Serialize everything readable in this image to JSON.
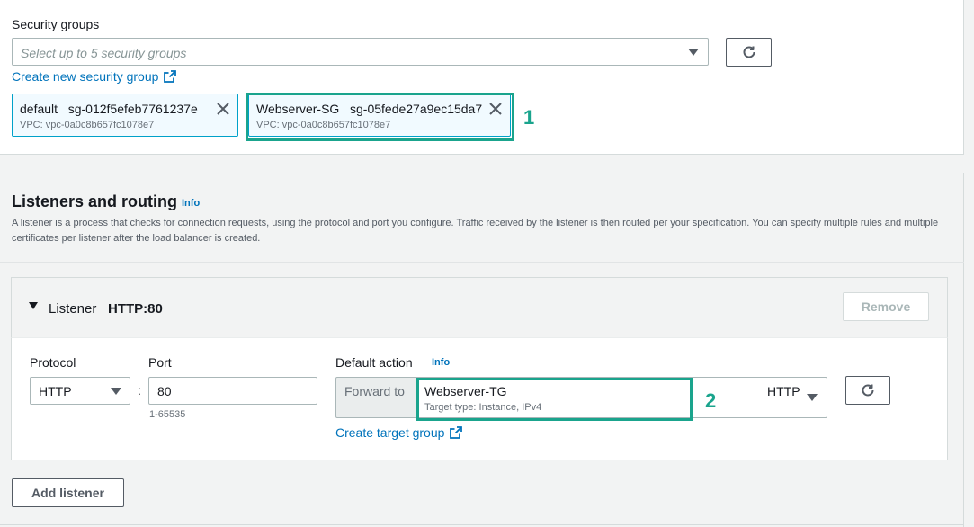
{
  "security_groups": {
    "title": "Security groups",
    "select_placeholder": "Select up to 5 security groups",
    "create_link": "Create new security group",
    "tokens": [
      {
        "name": "default",
        "id": "sg-012f5efeb7761237e",
        "vpc": "VPC: vpc-0a0c8b657fc1078e7"
      },
      {
        "name": "Webserver-SG",
        "id": "sg-05fede27a9ec15da7",
        "vpc": "VPC: vpc-0a0c8b657fc1078e7"
      }
    ],
    "marker": "1"
  },
  "listeners": {
    "title": "Listeners and routing",
    "info": "Info",
    "description": "A listener is a process that checks for connection requests, using the protocol and port you configure. Traffic received by the listener is then routed per your specification. You can specify multiple rules and multiple certificates per listener after the load balancer is created.",
    "listener_label": "Listener",
    "listener_value": "HTTP:80",
    "remove_label": "Remove",
    "protocol_label": "Protocol",
    "protocol_value": "HTTP",
    "colon": ":",
    "port_label": "Port",
    "port_value": "80",
    "port_hint": "1-65535",
    "default_action_label": "Default action",
    "default_action_info": "Info",
    "forward_to": "Forward to",
    "target_group_name": "Webserver-TG",
    "target_group_type": "Target type: Instance, IPv4",
    "target_group_protocol": "HTTP",
    "create_target_group": "Create target group",
    "marker": "2",
    "add_listener_label": "Add listener"
  },
  "colors": {
    "highlight": "#1aa48d",
    "link": "#0073bb",
    "token_border": "#00a1c9"
  },
  "icons": {
    "refresh": "refresh-icon",
    "external": "external-link-icon",
    "close": "close-icon",
    "dropdown": "caret-down-icon"
  }
}
